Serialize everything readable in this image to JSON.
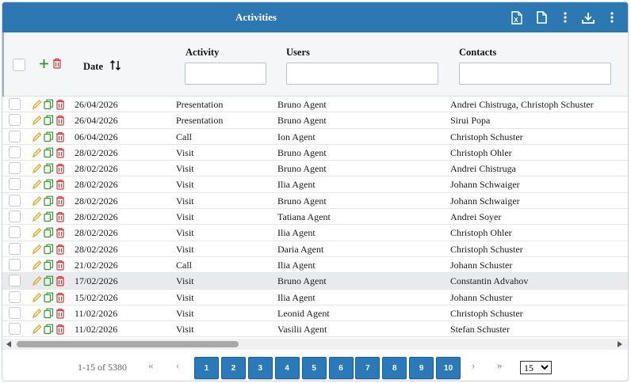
{
  "header": {
    "title": "Activities",
    "icons": [
      "excel-export-icon",
      "document-icon",
      "more-vertical-icon",
      "download-icon",
      "more-vertical-icon"
    ]
  },
  "columns": {
    "date": "Date",
    "activity": "Activity",
    "users": "Users",
    "contacts": "Contacts"
  },
  "filters": {
    "activity": "",
    "users": "",
    "contacts": ""
  },
  "rows": [
    {
      "date": "26/04/2026",
      "activity": "Presentation",
      "user": "Bruno Agent",
      "contact": "Andrei Chistruga, Christoph Schuster"
    },
    {
      "date": "26/04/2026",
      "activity": "Presentation",
      "user": "Bruno Agent",
      "contact": "Sirui Popa"
    },
    {
      "date": "06/04/2026",
      "activity": "Call",
      "user": "Ion Agent",
      "contact": "Christoph Schuster"
    },
    {
      "date": "28/02/2026",
      "activity": "Visit",
      "user": "Bruno Agent",
      "contact": "Christoph Ohler"
    },
    {
      "date": "28/02/2026",
      "activity": "Visit",
      "user": "Bruno Agent",
      "contact": "Andrei Chistruga"
    },
    {
      "date": "28/02/2026",
      "activity": "Visit",
      "user": "Ilia Agent",
      "contact": "Johann Schwaiger"
    },
    {
      "date": "28/02/2026",
      "activity": "Visit",
      "user": "Bruno Agent",
      "contact": "Johann Schwaiger"
    },
    {
      "date": "28/02/2026",
      "activity": "Visit",
      "user": "Tatiana Agent",
      "contact": "Andrei Soyer"
    },
    {
      "date": "28/02/2026",
      "activity": "Visit",
      "user": "Ilia Agent",
      "contact": "Christoph Ohler"
    },
    {
      "date": "28/02/2026",
      "activity": "Visit",
      "user": "Daria Agent",
      "contact": "Christoph Schuster"
    },
    {
      "date": "21/02/2026",
      "activity": "Call",
      "user": "Ilia Agent",
      "contact": "Johann Schuster"
    },
    {
      "date": "17/02/2026",
      "activity": "Visit",
      "user": "Bruno Agent",
      "contact": "Constantin Advahov"
    },
    {
      "date": "15/02/2026",
      "activity": "Visit",
      "user": "Ilia Agent",
      "contact": "Johann Schuster"
    },
    {
      "date": "11/02/2026",
      "activity": "Visit",
      "user": "Leonid Agent",
      "contact": "Christoph Schuster"
    },
    {
      "date": "11/02/2026",
      "activity": "Visit",
      "user": "Vasilii Agent",
      "contact": "Stefan Schuster"
    }
  ],
  "highlighted_row": 11,
  "pagination": {
    "info": "1-15 of 5380",
    "first": "«",
    "prev": "‹",
    "next": "›",
    "last": "»",
    "pages": [
      "1",
      "2",
      "3",
      "4",
      "5",
      "6",
      "7",
      "8",
      "9",
      "10"
    ],
    "page_size": "15",
    "page_size_options": [
      "15"
    ]
  },
  "colors": {
    "header_bg": "#2b78b3",
    "edit_icon": "#f0a020",
    "copy_icon": "#2a9a2a",
    "delete_icon": "#e03030",
    "add_icon": "#2a9a2a",
    "page_button": "#2a7ab9"
  }
}
